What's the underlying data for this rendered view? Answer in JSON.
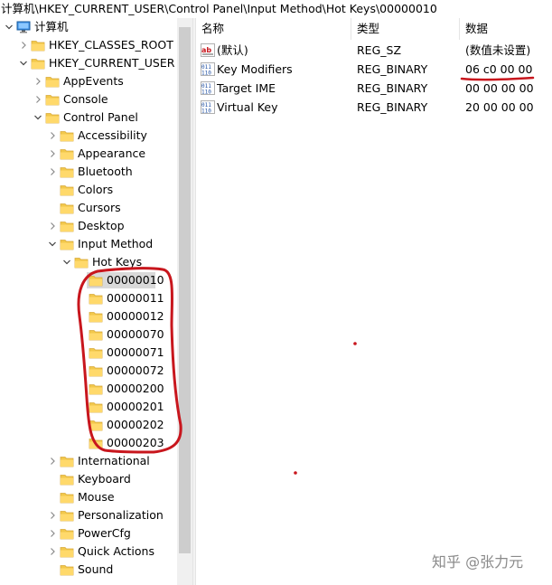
{
  "address_bar": {
    "path": "计算机\\HKEY_CURRENT_USER\\Control Panel\\Input Method\\Hot Keys\\00000010"
  },
  "tree": {
    "nodes": [
      {
        "label": "计算机",
        "level": 0,
        "expander": "expanded",
        "icon": "computer-icon"
      },
      {
        "label": "HKEY_CLASSES_ROOT",
        "level": 1,
        "expander": "collapsed",
        "icon": "folder-icon"
      },
      {
        "label": "HKEY_CURRENT_USER",
        "level": 1,
        "expander": "expanded",
        "icon": "folder-icon"
      },
      {
        "label": "AppEvents",
        "level": 2,
        "expander": "collapsed",
        "icon": "folder-icon"
      },
      {
        "label": "Console",
        "level": 2,
        "expander": "collapsed",
        "icon": "folder-icon"
      },
      {
        "label": "Control Panel",
        "level": 2,
        "expander": "expanded",
        "icon": "folder-icon"
      },
      {
        "label": "Accessibility",
        "level": 3,
        "expander": "collapsed",
        "icon": "folder-icon"
      },
      {
        "label": "Appearance",
        "level": 3,
        "expander": "collapsed",
        "icon": "folder-icon"
      },
      {
        "label": "Bluetooth",
        "level": 3,
        "expander": "collapsed",
        "icon": "folder-icon"
      },
      {
        "label": "Colors",
        "level": 3,
        "expander": "none",
        "icon": "folder-icon"
      },
      {
        "label": "Cursors",
        "level": 3,
        "expander": "none",
        "icon": "folder-icon"
      },
      {
        "label": "Desktop",
        "level": 3,
        "expander": "collapsed",
        "icon": "folder-icon"
      },
      {
        "label": "Input Method",
        "level": 3,
        "expander": "expanded",
        "icon": "folder-icon"
      },
      {
        "label": "Hot Keys",
        "level": 4,
        "expander": "expanded",
        "icon": "folder-icon"
      },
      {
        "label": "00000010",
        "level": 5,
        "expander": "none",
        "icon": "folder-icon",
        "selected": true
      },
      {
        "label": "00000011",
        "level": 5,
        "expander": "none",
        "icon": "folder-icon"
      },
      {
        "label": "00000012",
        "level": 5,
        "expander": "none",
        "icon": "folder-icon"
      },
      {
        "label": "00000070",
        "level": 5,
        "expander": "none",
        "icon": "folder-icon"
      },
      {
        "label": "00000071",
        "level": 5,
        "expander": "none",
        "icon": "folder-icon"
      },
      {
        "label": "00000072",
        "level": 5,
        "expander": "none",
        "icon": "folder-icon"
      },
      {
        "label": "00000200",
        "level": 5,
        "expander": "none",
        "icon": "folder-icon"
      },
      {
        "label": "00000201",
        "level": 5,
        "expander": "none",
        "icon": "folder-icon"
      },
      {
        "label": "00000202",
        "level": 5,
        "expander": "none",
        "icon": "folder-icon"
      },
      {
        "label": "00000203",
        "level": 5,
        "expander": "none",
        "icon": "folder-icon"
      },
      {
        "label": "International",
        "level": 3,
        "expander": "collapsed",
        "icon": "folder-icon"
      },
      {
        "label": "Keyboard",
        "level": 3,
        "expander": "none",
        "icon": "folder-icon"
      },
      {
        "label": "Mouse",
        "level": 3,
        "expander": "none",
        "icon": "folder-icon"
      },
      {
        "label": "Personalization",
        "level": 3,
        "expander": "collapsed",
        "icon": "folder-icon"
      },
      {
        "label": "PowerCfg",
        "level": 3,
        "expander": "collapsed",
        "icon": "folder-icon"
      },
      {
        "label": "Quick Actions",
        "level": 3,
        "expander": "collapsed",
        "icon": "folder-icon"
      },
      {
        "label": "Sound",
        "level": 3,
        "expander": "none",
        "icon": "folder-icon"
      }
    ]
  },
  "values_list": {
    "columns": {
      "name": "名称",
      "type": "类型",
      "data": "数据"
    },
    "rows": [
      {
        "name": "(默认)",
        "type": "REG_SZ",
        "data": "(数值未设置)",
        "icon": "string-value-icon"
      },
      {
        "name": "Key Modifiers",
        "type": "REG_BINARY",
        "data": "06 c0 00 00",
        "icon": "binary-value-icon"
      },
      {
        "name": "Target IME",
        "type": "REG_BINARY",
        "data": "00 00 00 00",
        "icon": "binary-value-icon"
      },
      {
        "name": "Virtual Key",
        "type": "REG_BINARY",
        "data": "20 00 00 00",
        "icon": "binary-value-icon"
      }
    ]
  },
  "watermark": "知乎 @张力元",
  "colors": {
    "annotation_red": "#c8161d",
    "folder_yellow": "#f2c84b",
    "selection_gray": "#d9d9d9"
  }
}
